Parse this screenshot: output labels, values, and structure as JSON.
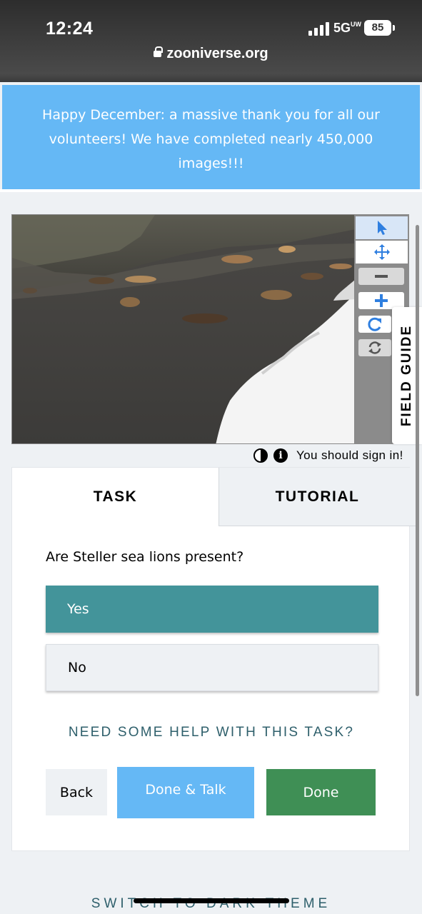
{
  "status_bar": {
    "time": "12:24",
    "network": "5G",
    "network_suffix": "UW",
    "battery": "85"
  },
  "browser": {
    "url": "zooniverse.org"
  },
  "banner": {
    "text": "Happy December: a massive thank you for all our volunteers! We have completed nearly 450,000 images!!!"
  },
  "viewer": {
    "field_guide_label": "FIELD GUIDE",
    "signin_text": "You should sign in!",
    "tools": [
      "pointer-icon",
      "pan-icon",
      "zoom-out-icon",
      "zoom-in-icon",
      "reset-icon",
      "rotate-icon"
    ]
  },
  "tabs": {
    "task": "TASK",
    "tutorial": "TUTORIAL"
  },
  "task": {
    "question": "Are Steller sea lions present?",
    "answers": [
      "Yes",
      "No"
    ],
    "selected": "Yes",
    "help_link": "NEED SOME HELP WITH THIS TASK?"
  },
  "actions": {
    "back": "Back",
    "done_talk": "Done & Talk",
    "done": "Done"
  },
  "footer": {
    "dark_theme": "SWITCH TO DARK THEME"
  },
  "colors": {
    "banner": "#65b8f5",
    "yes_selected": "#43949a",
    "done": "#3f8f55",
    "done_talk": "#65b8f5",
    "link": "#2e5f6b",
    "tool_icon": "#2f7fe0"
  }
}
